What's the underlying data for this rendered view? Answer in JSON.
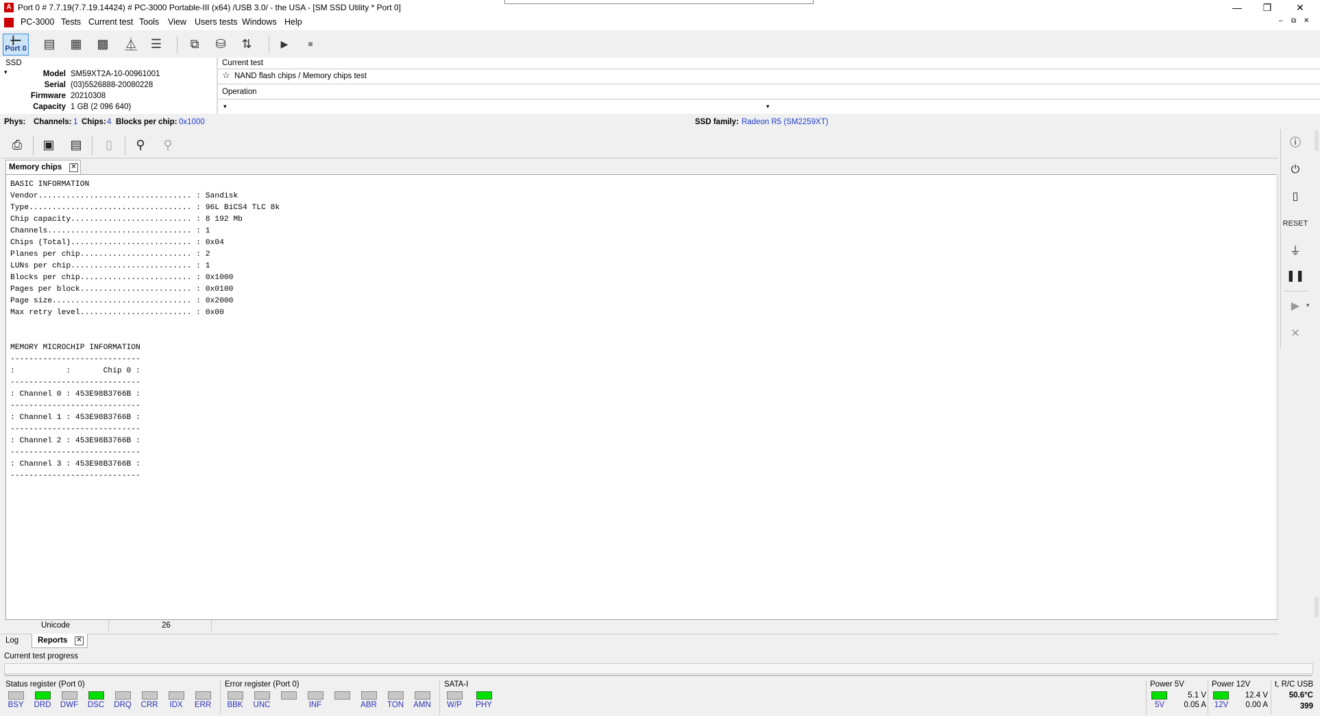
{
  "titlebar": {
    "title": "Port 0 # 7.7.19(7.7.19.14424) # PC-3000 Portable-III (x64) /USB 3.0/ - the USA - [SM SSD Utility * Port 0]",
    "app_icon": "pc3000-app-icon",
    "minimize": "—",
    "restore": "❐",
    "close": "✕"
  },
  "menubar": {
    "items": [
      "PC-3000",
      "Tests",
      "Current test",
      "Tools",
      "View",
      "Users tests",
      "Windows",
      "Help"
    ],
    "mdi_controls": [
      "–",
      "⧉",
      "✕"
    ]
  },
  "toolbar": {
    "port_label": "Port 0",
    "buttons": [
      "port-icon",
      "drive-info-icon",
      "chip-icon",
      "chips-icon",
      "scale-icon",
      "list-icon",
      "copy-icon",
      "disk-icon",
      "sort-icon",
      "play-icon",
      "stop-icon"
    ]
  },
  "device": {
    "type": "SSD",
    "dropdown": "▾",
    "model_label": "Model",
    "model": "SM59XT2A-10-00961001",
    "serial_label": "Serial",
    "serial": "(03)5526888-20080228",
    "firmware_label": "Firmware",
    "firmware": "20210308",
    "capacity_label": "Capacity",
    "capacity": "1 GB (2 096 640)"
  },
  "current_test": {
    "label": "Current test",
    "name": "NAND flash chips / Memory chips test",
    "operation_label": "Operation",
    "star": "☆"
  },
  "phys": {
    "label": "Phys:",
    "channels_label": "Channels:",
    "channels": "1",
    "chips_label": "Chips:",
    "chips": "4",
    "blocks_label": "Blocks per chip:",
    "blocks": "0x1000",
    "family_label": "SSD family:",
    "family": "Radeon R5 (SM2259XT)"
  },
  "report_tab": {
    "title": "Memory chips",
    "close": "✕"
  },
  "report_lines": [
    "BASIC INFORMATION",
    "Vendor................................. : Sandisk",
    "Type................................... : 96L BiCS4 TLC 8k",
    "Chip capacity.......................... : 8 192 Mb",
    "Channels............................... : 1",
    "Chips (Total).......................... : 0x04",
    "Planes per chip........................ : 2",
    "LUNs per chip.......................... : 1",
    "Blocks per chip........................ : 0x1000",
    "Pages per block........................ : 0x0100",
    "Page size.............................. : 0x2000",
    "Max retry level........................ : 0x00",
    "",
    "",
    "MEMORY MICROCHIP INFORMATION",
    "----------------------------",
    ":           :       Chip 0 :",
    "----------------------------",
    ": Channel 0 : 453E98B3766B :",
    "----------------------------",
    ": Channel 1 : 453E98B3766B :",
    "----------------------------",
    ": Channel 2 : 453E98B3766B :",
    "----------------------------",
    ": Channel 3 : 453E98B3766B :",
    "----------------------------"
  ],
  "editor_status": {
    "encoding": "Unicode",
    "position": "26"
  },
  "bottom_tabs": {
    "log": "Log",
    "reports": "Reports",
    "close": "✕"
  },
  "progress": {
    "label": "Current test progress",
    "value": 0
  },
  "status_register": {
    "title": "Status register (Port 0)",
    "leds": [
      {
        "name": "BSY",
        "on": false
      },
      {
        "name": "DRD",
        "on": true
      },
      {
        "name": "DWF",
        "on": false
      },
      {
        "name": "DSC",
        "on": true
      },
      {
        "name": "DRQ",
        "on": false
      },
      {
        "name": "CRR",
        "on": false
      },
      {
        "name": "IDX",
        "on": false
      },
      {
        "name": "ERR",
        "on": false
      }
    ]
  },
  "error_register": {
    "title": "Error register (Port 0)",
    "leds": [
      {
        "name": "BBK",
        "on": false
      },
      {
        "name": "UNC",
        "on": false
      },
      {
        "name": "",
        "on": false
      },
      {
        "name": "INF",
        "on": false
      },
      {
        "name": "",
        "on": false
      },
      {
        "name": "ABR",
        "on": false
      },
      {
        "name": "TON",
        "on": false
      },
      {
        "name": "AMN",
        "on": false
      }
    ]
  },
  "sata": {
    "title": "SATA-I",
    "leds": [
      {
        "name": "W/P",
        "on": false
      },
      {
        "name": "PHY",
        "on": true
      }
    ]
  },
  "power5": {
    "title": "Power 5V",
    "led": "5V",
    "voltage": "5.1 V",
    "current": "0.05 A"
  },
  "power12": {
    "title": "Power 12V",
    "led": "12V",
    "voltage": "12.4 V",
    "current": "0.00 A"
  },
  "temp": {
    "title": "t, R/C USB",
    "value": "50.6°C",
    "count": "399"
  },
  "accent_colors": {
    "led_on": "#00e000",
    "link_blue": "#1f3ccc",
    "title_red": "#cc0000"
  }
}
